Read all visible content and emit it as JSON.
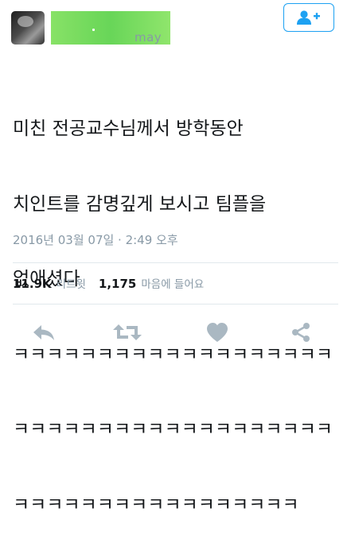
{
  "tweet": {
    "handle_tail": "may",
    "text_lines": [
      "미친 전공교수님께서 방학동안",
      "치인트를 감명깊게 보시고 팀플을",
      "없애셨다",
      "ㅋㅋㅋㅋㅋㅋㅋㅋㅋㅋㅋㅋㅋㅋㅋㅋㅋㅋㅋ",
      "ㅋㅋㅋㅋㅋㅋㅋㅋㅋㅋㅋㅋㅋㅋㅋㅋㅋㅋㅋ",
      "ㅋㅋㅋㅋㅋㅋㅋㅋㅋㅋㅋㅋㅋㅋㅋㅋㅋ"
    ],
    "timestamp": "2016년 03월 07일 · 2:49 오후"
  },
  "stats": {
    "retweets_count": "11.9K",
    "retweets_label": "리트윗",
    "likes_count": "1,175",
    "likes_label": "마음에 들어요"
  },
  "colors": {
    "accent": "#1da1f2",
    "muted": "#8899a6",
    "action_icon": "#aab8c2"
  },
  "icons": {
    "follow": "follow-user-icon",
    "reply": "reply-icon",
    "retweet": "retweet-icon",
    "like": "heart-icon",
    "share": "share-icon"
  }
}
